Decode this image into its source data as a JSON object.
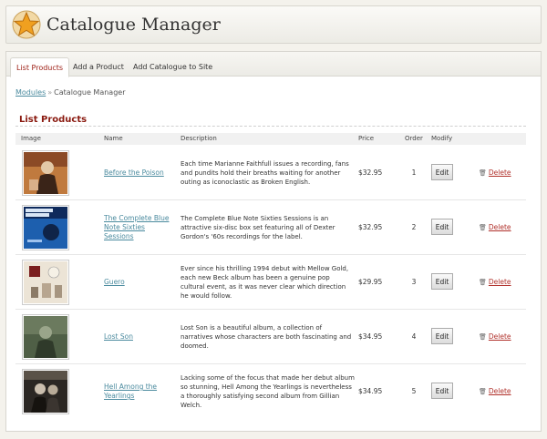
{
  "app": {
    "title": "Catalogue Manager",
    "logo_icon": "star-icon"
  },
  "tabs": [
    {
      "label": "List Products",
      "active": true
    },
    {
      "label": "Add a Product",
      "active": false
    },
    {
      "label": "Add Catalogue to Site",
      "active": false
    }
  ],
  "breadcrumb": {
    "link": "Modules",
    "separator": "»",
    "current": "Catalogue Manager"
  },
  "section": {
    "title": "List Products"
  },
  "table": {
    "columns": [
      "Image",
      "Name",
      "Description",
      "Price",
      "Order",
      "Modify"
    ],
    "edit_label": "Edit",
    "delete_label": "Delete",
    "rows": [
      {
        "name": "Before the Poison",
        "description": "Each time Marianne Faithfull issues a recording, fans and pundits hold their breaths waiting for another outing as iconoclastic as Broken English.",
        "price": "$32.95",
        "order": "1"
      },
      {
        "name": "The Complete Blue Note Sixties Sessions",
        "description": "The Complete Blue Note Sixties Sessions is an attractive six-disc box set featuring all of Dexter Gordon's '60s recordings for the label.",
        "price": "$32.95",
        "order": "2"
      },
      {
        "name": "Guero",
        "description": "Ever since his thrilling 1994 debut with Mellow Gold, each new Beck album has been a genuine pop cultural event, as it was never clear which direction he would follow.",
        "price": "$29.95",
        "order": "3"
      },
      {
        "name": "Lost Son",
        "description": "Lost Son is a beautiful album, a collection of narratives whose characters are both fascinating and doomed.",
        "price": "$34.95",
        "order": "4"
      },
      {
        "name": "Hell Among the Yearlings",
        "description": "Lacking some of the focus that made her debut album so stunning, Hell Among the Yearlings is nevertheless a thoroughly satisfying second album from Gillian Welch.",
        "price": "$34.95",
        "order": "5"
      }
    ]
  },
  "colors": {
    "accent": "#8a1a10",
    "link": "#4a8a9e",
    "delete": "#b0302a"
  }
}
